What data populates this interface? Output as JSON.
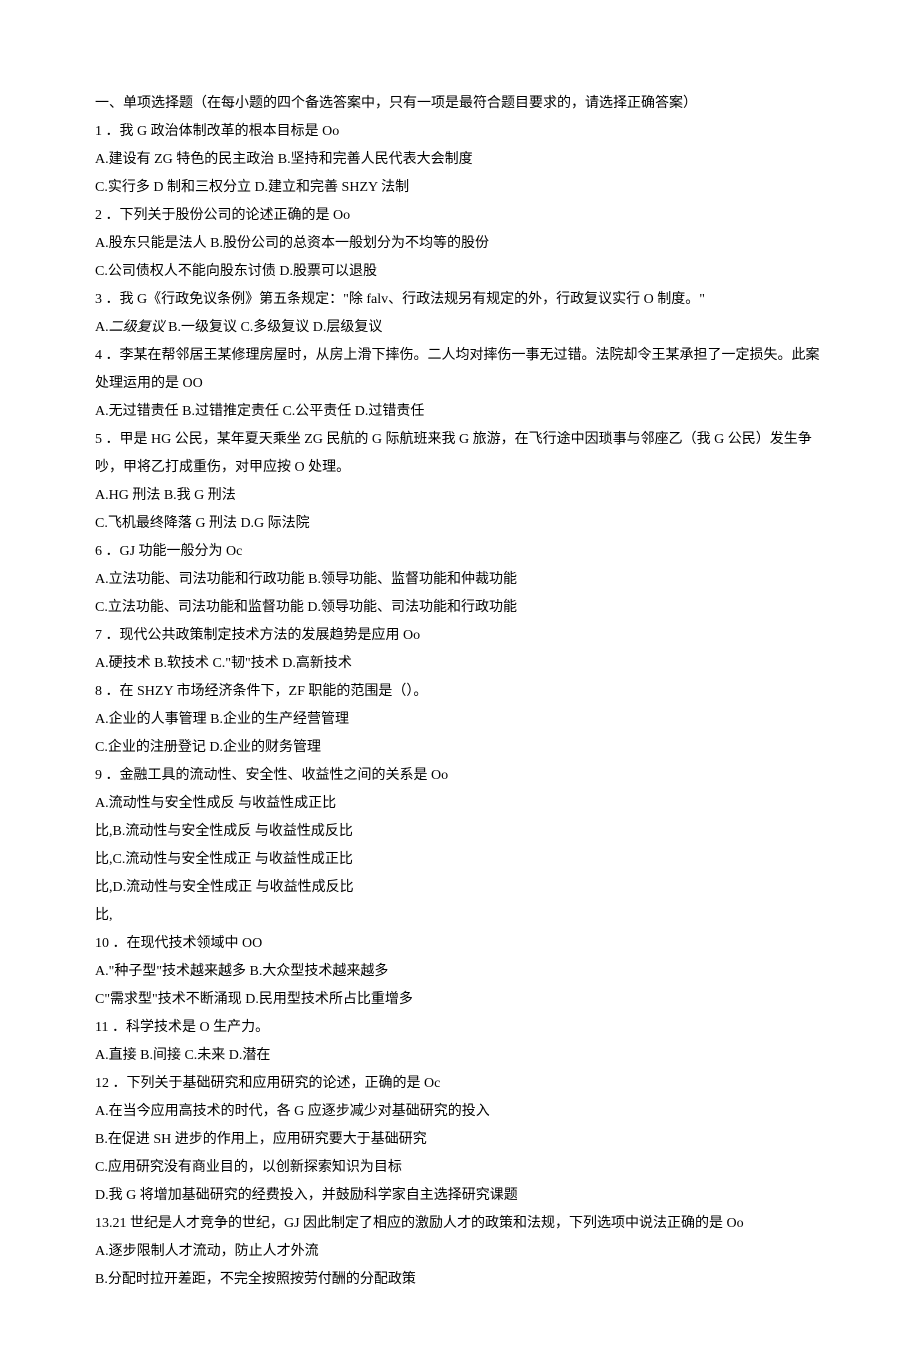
{
  "lines": [
    "一、单项选择题（在每小题的四个备选答案中，只有一项是最符合题目要求的，请选择正确答案）",
    "1 ．我 G 政治体制改革的根本目标是 Oo",
    "A.建设有 ZG 特色的民主政治 B.坚持和完善人民代表大会制度",
    "C.实行多 D 制和三权分立 D.建立和完善 SHZY 法制",
    "2 ．下列关于股份公司的论述正确的是 Oo",
    "A.股东只能是法人 B.股份公司的总资本一般划分为不均等的股份",
    "C.公司债权人不能向股东讨债 D.股票可以退股",
    "3 ．我 G《行政免议条例》第五条规定：\"除 falv、行政法规另有规定的外，行政复议实行 O 制度。\"",
    "A.二级复议 B.一级复议 C.多级复议 D.层级复议",
    "4 ．李某在帮邻居王某修理房屋时，从房上滑下摔伤。二人均对摔伤一事无过错。法院却令王某承担了一定损失。此案处理运用的是 OO",
    "A.无过错责任 B.过错推定责任 C.公平责任 D.过错责任",
    "5 ．甲是 HG 公民，某年夏天乘坐 ZG 民航的 G 际航班来我 G 旅游，在飞行途中因琐事与邻座乙（我 G 公民）发生争吵，甲将乙打成重伤，对甲应按 O 处理。",
    "A.HG 刑法 B.我 G 刑法",
    "C.飞机最终降落 G 刑法 D.G 际法院",
    "6 ．GJ 功能一般分为 Oc",
    "A.立法功能、司法功能和行政功能 B.领导功能、监督功能和仲裁功能",
    "C.立法功能、司法功能和监督功能 D.领导功能、司法功能和行政功能",
    "7 ．现代公共政策制定技术方法的发展趋势是应用 Oo",
    "A.硬技术 B.软技术 C.\"韧\"技术 D.高新技术",
    "8 ．在 SHZY 市场经济条件下，ZF 职能的范围是（）。",
    "A.企业的人事管理 B.企业的生产经营管理",
    "C.企业的注册登记 D.企业的财务管理",
    "9 ．金融工具的流动性、安全性、收益性之间的关系是 Oo",
    "A.流动性与安全性成反 与收益性成正比",
    "比,B.流动性与安全性成反 与收益性成反比",
    "比,C.流动性与安全性成正 与收益性成正比",
    "比,D.流动性与安全性成正 与收益性成反比",
    "比,",
    "10 ．在现代技术领域中 OO",
    "A.\"种子型\"技术越来越多 B.大众型技术越来越多",
    "C\"需求型\"技术不断涌现 D.民用型技术所占比重增多",
    "11 ．科学技术是 O 生产力。",
    "A.直接 B.间接 C.未来 D.潜在",
    "12 ．下列关于基础研究和应用研究的论述，正确的是 Oc",
    "A.在当今应用高技术的时代，各 G 应逐步减少对基础研究的投入",
    "B.在促进 SH 进步的作用上，应用研究要大于基础研究",
    "C.应用研究没有商业目的，以创新探索知识为目标",
    "D.我 G 将增加基础研究的经费投入，并鼓励科学家自主选择研究课题",
    "13.21 世纪是人才竞争的世纪，GJ 因此制定了相应的激励人才的政策和法规，下列选项中说法正确的是 Oo",
    "A.逐步限制人才流动，防止人才外流",
    "B.分配时拉开差距，不完全按照按劳付酬的分配政策"
  ],
  "italicSegments": {
    "8": "二级复议"
  }
}
